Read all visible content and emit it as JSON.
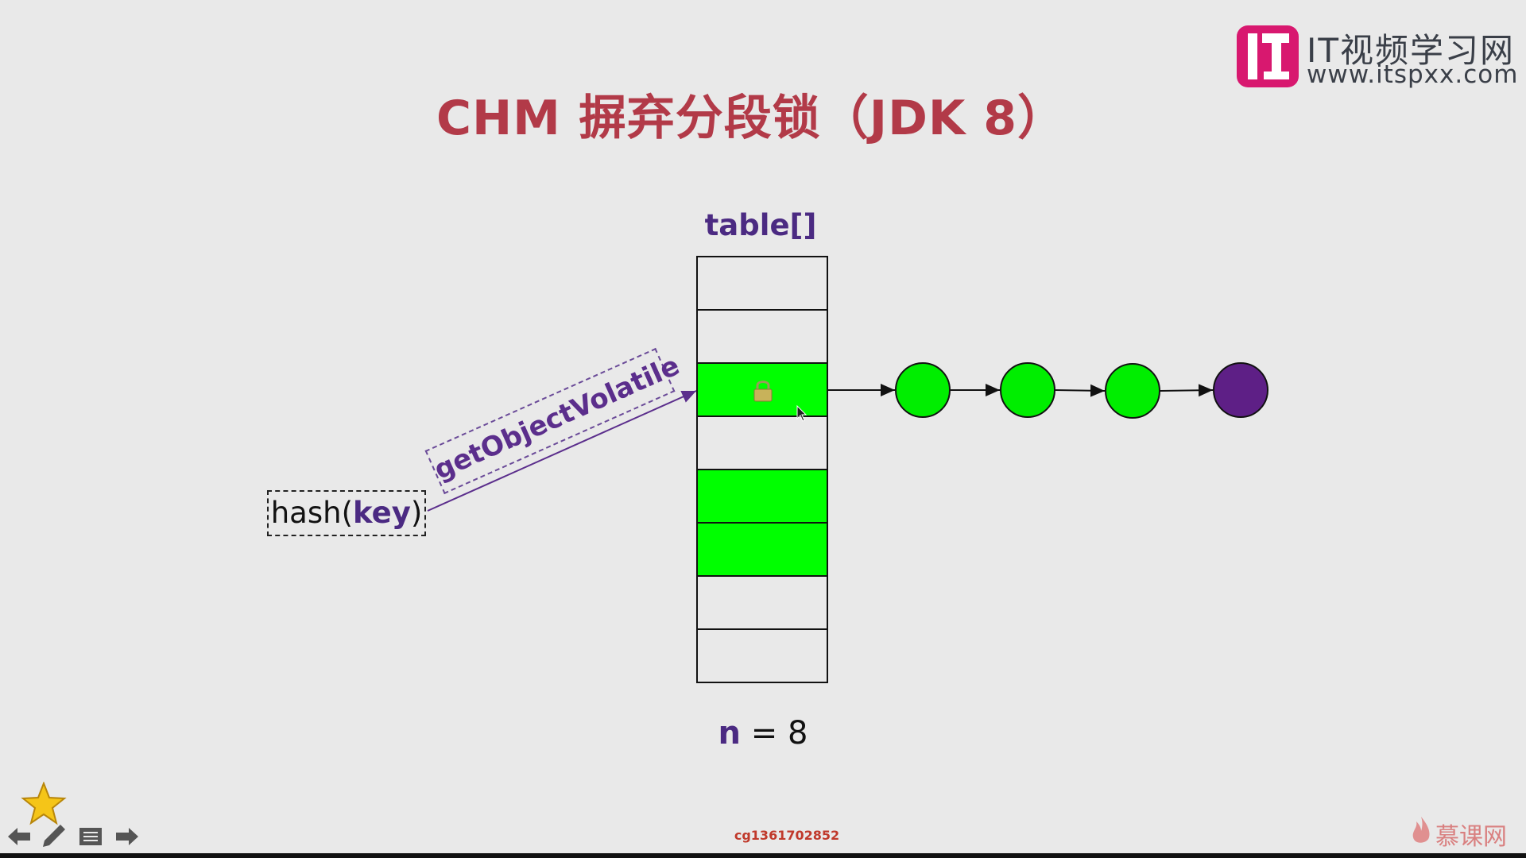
{
  "slide": {
    "title": "CHM 摒弃分段锁（JDK 8）"
  },
  "logo": {
    "name": "IT视频学习网",
    "url": "www.itspxx.com"
  },
  "diagram": {
    "table_label": "table[]",
    "cells": [
      {
        "state": "empty"
      },
      {
        "state": "empty"
      },
      {
        "state": "green",
        "locked": true
      },
      {
        "state": "empty"
      },
      {
        "state": "green"
      },
      {
        "state": "green"
      },
      {
        "state": "empty"
      },
      {
        "state": "empty"
      }
    ],
    "chain_nodes": [
      {
        "color": "#00ee00"
      },
      {
        "color": "#00ee00"
      },
      {
        "color": "#00ee00"
      },
      {
        "color": "#5e1f86"
      }
    ],
    "hash_prefix": "hash(",
    "hash_key": "key",
    "hash_suffix": ")",
    "method_label": "getObjectVolatile",
    "n_var": "n",
    "n_eq": " = 8"
  },
  "footer": {
    "watermark_id": "cg1361702852",
    "brand": "慕课网"
  },
  "colors": {
    "title": "#b23a48",
    "accent_purple": "#4b2a82",
    "cell_green": "#00ff00"
  }
}
